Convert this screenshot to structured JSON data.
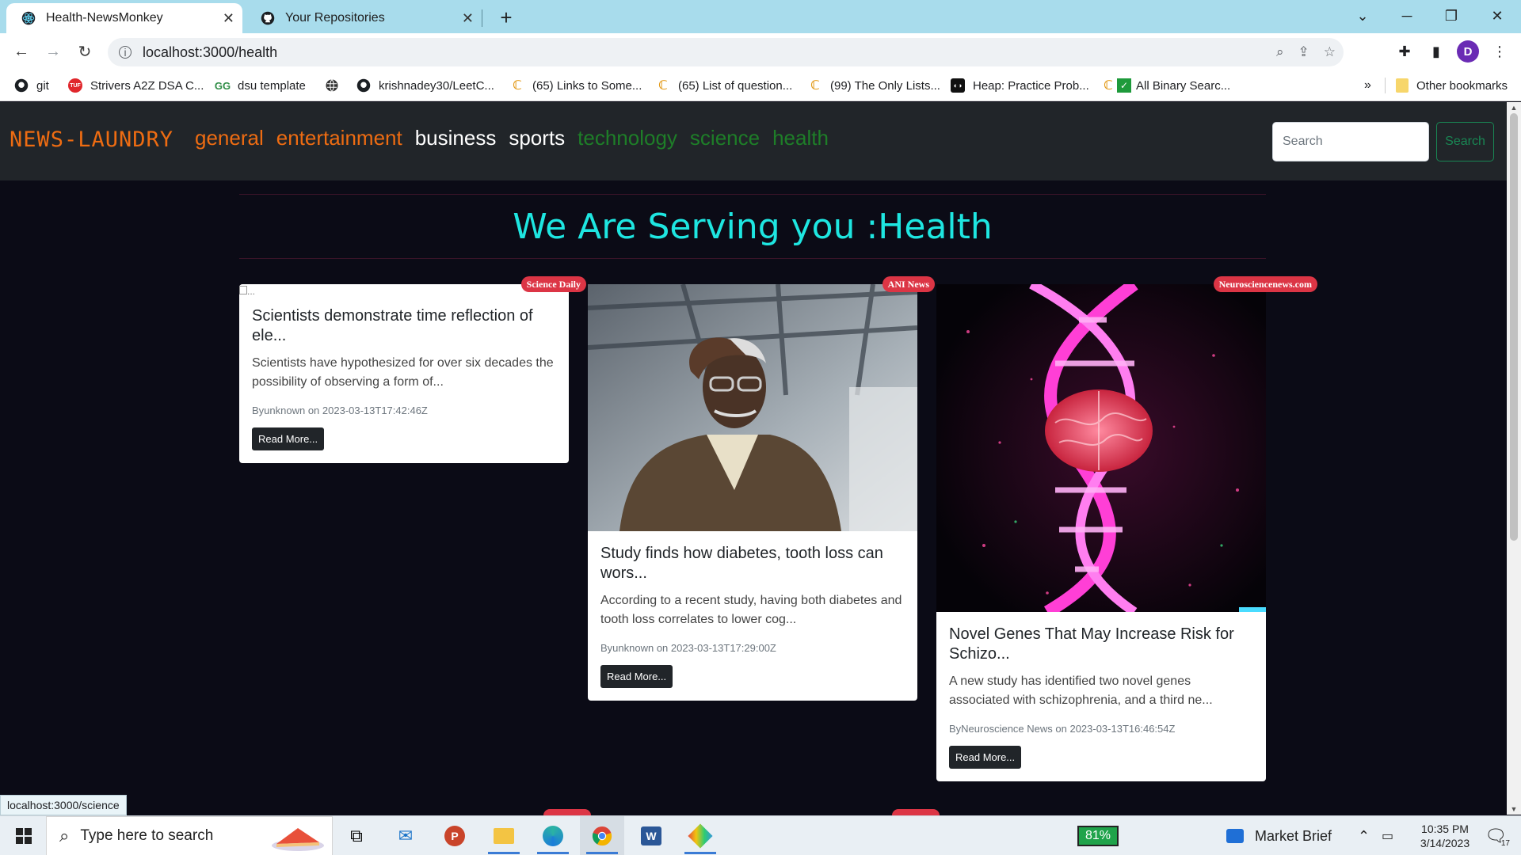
{
  "browser": {
    "tabs": [
      {
        "title": "Health-NewsMonkey",
        "active": true,
        "favicon": "react-icon"
      },
      {
        "title": "Your Repositories",
        "active": false,
        "favicon": "github-icon"
      }
    ],
    "url": "localhost:3000/health",
    "profile_initial": "D",
    "bookmarks": [
      {
        "label": "git",
        "icon": "github-icon"
      },
      {
        "label": "Strivers A2Z DSA C...",
        "icon": "tuf-icon"
      },
      {
        "label": "dsu template",
        "icon": "gfg-icon"
      },
      {
        "label": "",
        "icon": "globe-icon"
      },
      {
        "label": "krishnadey30/LeetC...",
        "icon": "github-icon"
      },
      {
        "label": "(65) Links to Some...",
        "icon": "leetcode-icon"
      },
      {
        "label": "(65) List of question...",
        "icon": "leetcode-icon"
      },
      {
        "label": "(99) The Only Lists...",
        "icon": "leetcode-icon"
      },
      {
        "label": "Heap: Practice Prob...",
        "icon": "codingninjas-icon"
      },
      {
        "label": "All Binary Searc...",
        "icon": "leetcode-check-icon"
      }
    ],
    "bookmarks_overflow": "»",
    "other_bookmarks": "Other bookmarks",
    "status_url": "localhost:3000/science"
  },
  "app": {
    "brand": "NEWS-LAUNDRY",
    "nav": [
      {
        "label": "general",
        "color": "#ee6c12"
      },
      {
        "label": "entertainment",
        "color": "#ee6c12"
      },
      {
        "label": "business",
        "color": "#ffffff"
      },
      {
        "label": "sports",
        "color": "#ffffff"
      },
      {
        "label": "technology",
        "color": "#1e7e28"
      },
      {
        "label": "science",
        "color": "#1e7e28"
      },
      {
        "label": "health",
        "color": "#1e7e28"
      }
    ],
    "search_placeholder": "Search",
    "search_button": "Search",
    "heading": "We Are Serving you :Health",
    "read_more": "Read More...",
    "broken_image_alt": "...",
    "cards": [
      {
        "source": "Science Daily",
        "title": "Scientists demonstrate time reflection of ele...",
        "description": "Scientists have hypothesized for over six decades the possibility of observing a form of...",
        "meta": "Byunknown on 2023-03-13T17:42:46Z",
        "image": "broken"
      },
      {
        "source": "ANI News",
        "title": "Study finds how diabetes, tooth loss can wors...",
        "description": "According to a recent study, having both diabetes and tooth loss correlates to lower cog...",
        "meta": "Byunknown on 2023-03-13T17:29:00Z",
        "image": "elderly-man-photo"
      },
      {
        "source": "Neurosciencenews.com",
        "title": "Novel Genes That May Increase Risk for Schizo...",
        "description": "A new study has identified two novel genes associated with schizophrenia, and a third ne...",
        "meta": "ByNeuroscience News on 2023-03-13T16:46:54Z",
        "image": "dna-brain-illustration"
      }
    ]
  },
  "taskbar": {
    "search_placeholder": "Type here to search",
    "battery": "81%",
    "news_widget": "Market Brief",
    "time": "10:35 PM",
    "date": "3/14/2023",
    "notifications": "17"
  }
}
